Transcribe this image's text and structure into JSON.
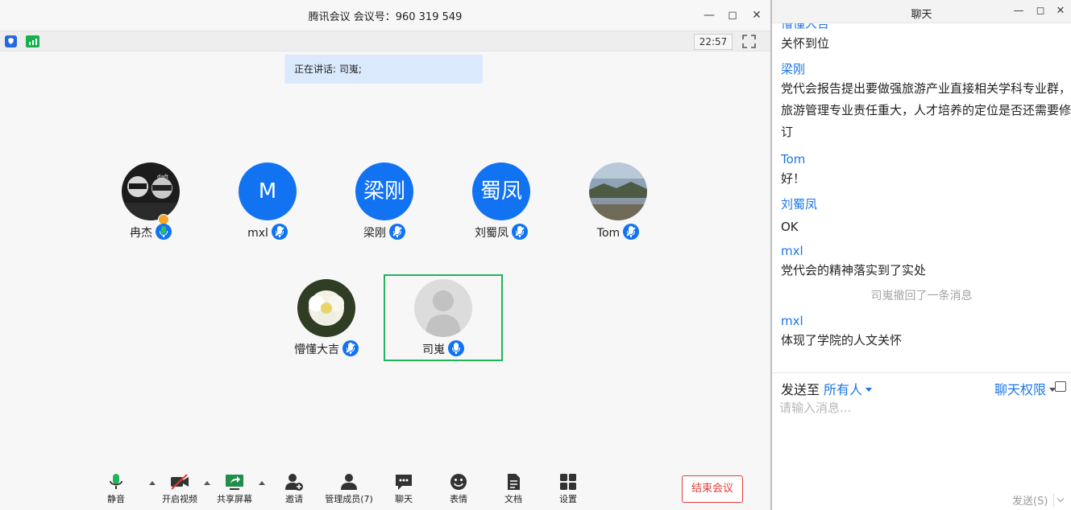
{
  "meeting": {
    "title": "腾讯会议 会议号：960 319 549",
    "clock": "22:57",
    "speaking": "正在讲话: 司嵬;",
    "participants": [
      {
        "name": "冉杰",
        "avatar_type": "photo",
        "avatar_label": "",
        "mic": "on",
        "host": true
      },
      {
        "name": "mxl",
        "avatar_type": "text",
        "avatar_label": "M",
        "mic": "muted",
        "host": false
      },
      {
        "name": "梁刚",
        "avatar_type": "text",
        "avatar_label": "梁刚",
        "mic": "muted",
        "host": false
      },
      {
        "name": "刘蜀凤",
        "avatar_type": "text",
        "avatar_label": "蜀凤",
        "mic": "muted",
        "host": false
      },
      {
        "name": "Tom",
        "avatar_type": "photo",
        "avatar_label": "",
        "mic": "muted",
        "host": false
      },
      {
        "name": "懵懂大吉",
        "avatar_type": "photo",
        "avatar_label": "",
        "mic": "muted",
        "host": false
      },
      {
        "name": "司嵬",
        "avatar_type": "placeholder",
        "avatar_label": "",
        "mic": "on",
        "host": false,
        "selected": true
      }
    ],
    "toolbar": {
      "mute": "静音",
      "video": "开启视频",
      "share": "共享屏幕",
      "invite": "邀请",
      "manage": "管理成员(7)",
      "chat": "聊天",
      "reaction": "表情",
      "docs": "文档",
      "settings": "设置",
      "end": "结束会议"
    },
    "colors": {
      "accent": "#1173f2",
      "end": "#e53b3b",
      "active_frame": "#22b45a",
      "speaking_bg": "#dae9fb"
    }
  },
  "chat": {
    "title": "聊天",
    "messages": [
      {
        "sender": "懵懂大吉",
        "text": "关怀到位"
      },
      {
        "sender": "梁刚",
        "text": "党代会报告提出要做强旅游产业直接相关学科专业群，旅游管理专业责任重大，人才培养的定位是否还需要修订"
      },
      {
        "sender": "Tom",
        "text": "好！"
      },
      {
        "sender": "刘蜀凤",
        "text": "OK"
      },
      {
        "sender": "mxl",
        "text": "党代会的精神落实到了实处"
      },
      {
        "recall": "司嵬撤回了一条消息"
      },
      {
        "sender": "mxl",
        "text": "体现了学院的人文关怀"
      }
    ],
    "send_to_label": "发送至",
    "send_to_value": "所有人",
    "permission": "聊天权限",
    "input_placeholder": "请输入消息...",
    "send_button": "发送(S)"
  }
}
